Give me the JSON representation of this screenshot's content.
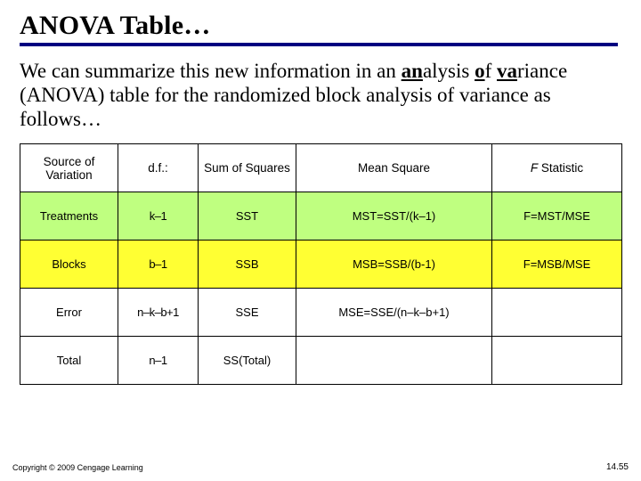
{
  "title": "ANOVA Table…",
  "intro_html": "We can summarize this new information in an <span class='b'><span class='u'>an</span></span>alysis <span class='b'><span class='u'>o</span></span>f <span class='b'><span class='u'>va</span></span>riance (ANOVA) table for the randomized block analysis of variance as follows…",
  "table": {
    "head": {
      "source": "Source of Variation",
      "df": "d.f.:",
      "ss": "Sum of Squares",
      "ms": "Mean Square",
      "f_prefix": "F",
      "f_suffix": " Statistic"
    },
    "rows": [
      {
        "highlight": "green",
        "source": "Treatments",
        "df": "k–1",
        "ss": "SST",
        "ms": "MST=SST/(k–1)",
        "f": "F=MST/MSE"
      },
      {
        "highlight": "yellow",
        "source": "Blocks",
        "df": "b–1",
        "ss": "SSB",
        "ms": "MSB=SSB/(b-1)",
        "f": "F=MSB/MSE"
      },
      {
        "highlight": "",
        "source": "Error",
        "df": "n–k–b+1",
        "ss": "SSE",
        "ms": "MSE=SSE/(n–k–b+1)",
        "f": ""
      },
      {
        "highlight": "",
        "source": "Total",
        "df": "n–1",
        "ss": "SS(Total)",
        "ms": "",
        "f": ""
      }
    ]
  },
  "footer": "Copyright © 2009 Cengage Learning",
  "pagenum": "14.55",
  "chart_data": {
    "type": "table",
    "title": "ANOVA Table (Randomized Block)",
    "columns": [
      "Source of Variation",
      "d.f.",
      "Sum of Squares",
      "Mean Square",
      "F Statistic"
    ],
    "rows": [
      [
        "Treatments",
        "k−1",
        "SST",
        "MST=SST/(k−1)",
        "F=MST/MSE"
      ],
      [
        "Blocks",
        "b−1",
        "SSB",
        "MSB=SSB/(b−1)",
        "F=MSB/MSE"
      ],
      [
        "Error",
        "n−k−b+1",
        "SSE",
        "MSE=SSE/(n−k−b+1)",
        ""
      ],
      [
        "Total",
        "n−1",
        "SS(Total)",
        "",
        ""
      ]
    ]
  }
}
